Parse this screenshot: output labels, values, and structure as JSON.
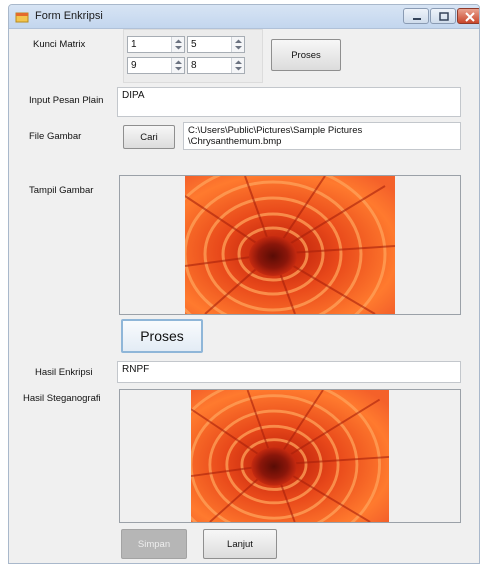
{
  "window": {
    "title": "Form Enkripsi",
    "icons": {
      "app": "form-icon",
      "minimize": "minimize-icon",
      "maximize": "maximize-icon",
      "close": "close-icon"
    }
  },
  "kunci_matrix": {
    "label": "Kunci Matrix",
    "values": [
      "1",
      "5",
      "9",
      "8"
    ],
    "proses_label": "Proses"
  },
  "input_pesan": {
    "label": "Input Pesan Plain",
    "value": "DIPA"
  },
  "file_gambar": {
    "label": "File Gambar",
    "cari_label": "Cari",
    "path_line1": "C:\\Users\\Public\\Pictures\\Sample Pictures",
    "path_line2": "\\Chrysanthemum.bmp"
  },
  "tampil_gambar": {
    "label": "Tampil Gambar",
    "image": "chrysanthemum-image"
  },
  "proses_big": {
    "label": "Proses"
  },
  "hasil_enkripsi": {
    "label": "Hasil Enkripsi",
    "value": "RNPF"
  },
  "hasil_stegano": {
    "label": "Hasil Steganografi",
    "image": "chrysanthemum-image"
  },
  "actions": {
    "simpan_label": "Simpan",
    "lanjut_label": "Lanjut"
  },
  "colors": {
    "petal_dark": "#c8200a",
    "petal_light": "#ff8a3c",
    "center": "#7a1308"
  }
}
